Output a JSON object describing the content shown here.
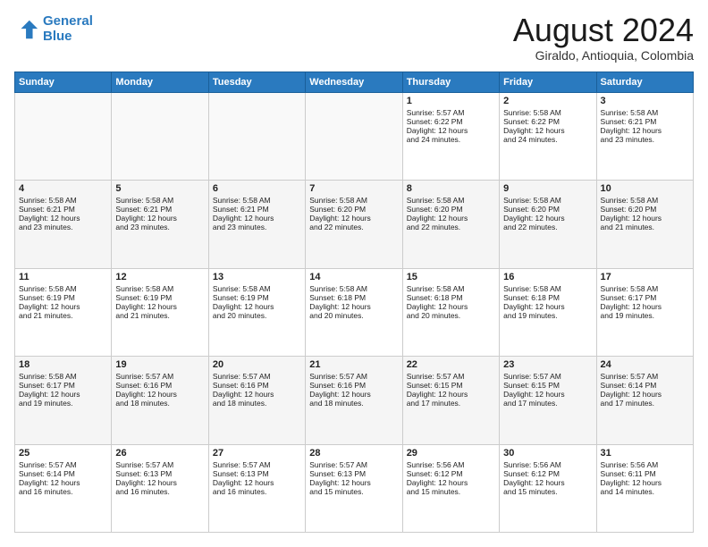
{
  "logo": {
    "line1": "General",
    "line2": "Blue"
  },
  "title": "August 2024",
  "location": "Giraldo, Antioquia, Colombia",
  "headers": [
    "Sunday",
    "Monday",
    "Tuesday",
    "Wednesday",
    "Thursday",
    "Friday",
    "Saturday"
  ],
  "weeks": [
    [
      {
        "day": "",
        "info": ""
      },
      {
        "day": "",
        "info": ""
      },
      {
        "day": "",
        "info": ""
      },
      {
        "day": "",
        "info": ""
      },
      {
        "day": "1",
        "info": "Sunrise: 5:57 AM\nSunset: 6:22 PM\nDaylight: 12 hours\nand 24 minutes."
      },
      {
        "day": "2",
        "info": "Sunrise: 5:58 AM\nSunset: 6:22 PM\nDaylight: 12 hours\nand 24 minutes."
      },
      {
        "day": "3",
        "info": "Sunrise: 5:58 AM\nSunset: 6:21 PM\nDaylight: 12 hours\nand 23 minutes."
      }
    ],
    [
      {
        "day": "4",
        "info": "Sunrise: 5:58 AM\nSunset: 6:21 PM\nDaylight: 12 hours\nand 23 minutes."
      },
      {
        "day": "5",
        "info": "Sunrise: 5:58 AM\nSunset: 6:21 PM\nDaylight: 12 hours\nand 23 minutes."
      },
      {
        "day": "6",
        "info": "Sunrise: 5:58 AM\nSunset: 6:21 PM\nDaylight: 12 hours\nand 23 minutes."
      },
      {
        "day": "7",
        "info": "Sunrise: 5:58 AM\nSunset: 6:20 PM\nDaylight: 12 hours\nand 22 minutes."
      },
      {
        "day": "8",
        "info": "Sunrise: 5:58 AM\nSunset: 6:20 PM\nDaylight: 12 hours\nand 22 minutes."
      },
      {
        "day": "9",
        "info": "Sunrise: 5:58 AM\nSunset: 6:20 PM\nDaylight: 12 hours\nand 22 minutes."
      },
      {
        "day": "10",
        "info": "Sunrise: 5:58 AM\nSunset: 6:20 PM\nDaylight: 12 hours\nand 21 minutes."
      }
    ],
    [
      {
        "day": "11",
        "info": "Sunrise: 5:58 AM\nSunset: 6:19 PM\nDaylight: 12 hours\nand 21 minutes."
      },
      {
        "day": "12",
        "info": "Sunrise: 5:58 AM\nSunset: 6:19 PM\nDaylight: 12 hours\nand 21 minutes."
      },
      {
        "day": "13",
        "info": "Sunrise: 5:58 AM\nSunset: 6:19 PM\nDaylight: 12 hours\nand 20 minutes."
      },
      {
        "day": "14",
        "info": "Sunrise: 5:58 AM\nSunset: 6:18 PM\nDaylight: 12 hours\nand 20 minutes."
      },
      {
        "day": "15",
        "info": "Sunrise: 5:58 AM\nSunset: 6:18 PM\nDaylight: 12 hours\nand 20 minutes."
      },
      {
        "day": "16",
        "info": "Sunrise: 5:58 AM\nSunset: 6:18 PM\nDaylight: 12 hours\nand 19 minutes."
      },
      {
        "day": "17",
        "info": "Sunrise: 5:58 AM\nSunset: 6:17 PM\nDaylight: 12 hours\nand 19 minutes."
      }
    ],
    [
      {
        "day": "18",
        "info": "Sunrise: 5:58 AM\nSunset: 6:17 PM\nDaylight: 12 hours\nand 19 minutes."
      },
      {
        "day": "19",
        "info": "Sunrise: 5:57 AM\nSunset: 6:16 PM\nDaylight: 12 hours\nand 18 minutes."
      },
      {
        "day": "20",
        "info": "Sunrise: 5:57 AM\nSunset: 6:16 PM\nDaylight: 12 hours\nand 18 minutes."
      },
      {
        "day": "21",
        "info": "Sunrise: 5:57 AM\nSunset: 6:16 PM\nDaylight: 12 hours\nand 18 minutes."
      },
      {
        "day": "22",
        "info": "Sunrise: 5:57 AM\nSunset: 6:15 PM\nDaylight: 12 hours\nand 17 minutes."
      },
      {
        "day": "23",
        "info": "Sunrise: 5:57 AM\nSunset: 6:15 PM\nDaylight: 12 hours\nand 17 minutes."
      },
      {
        "day": "24",
        "info": "Sunrise: 5:57 AM\nSunset: 6:14 PM\nDaylight: 12 hours\nand 17 minutes."
      }
    ],
    [
      {
        "day": "25",
        "info": "Sunrise: 5:57 AM\nSunset: 6:14 PM\nDaylight: 12 hours\nand 16 minutes."
      },
      {
        "day": "26",
        "info": "Sunrise: 5:57 AM\nSunset: 6:13 PM\nDaylight: 12 hours\nand 16 minutes."
      },
      {
        "day": "27",
        "info": "Sunrise: 5:57 AM\nSunset: 6:13 PM\nDaylight: 12 hours\nand 16 minutes."
      },
      {
        "day": "28",
        "info": "Sunrise: 5:57 AM\nSunset: 6:13 PM\nDaylight: 12 hours\nand 15 minutes."
      },
      {
        "day": "29",
        "info": "Sunrise: 5:56 AM\nSunset: 6:12 PM\nDaylight: 12 hours\nand 15 minutes."
      },
      {
        "day": "30",
        "info": "Sunrise: 5:56 AM\nSunset: 6:12 PM\nDaylight: 12 hours\nand 15 minutes."
      },
      {
        "day": "31",
        "info": "Sunrise: 5:56 AM\nSunset: 6:11 PM\nDaylight: 12 hours\nand 14 minutes."
      }
    ]
  ]
}
